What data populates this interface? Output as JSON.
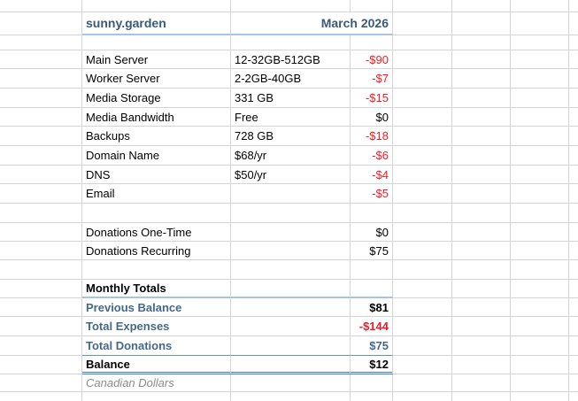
{
  "sheet": {
    "title": "sunny.garden",
    "period": "March 2026",
    "footer_note": "Canadian Dollars",
    "expenses": [
      {
        "label": "Main Server",
        "detail": "12-32GB-512GB",
        "amount": "-$90"
      },
      {
        "label": "Worker Server",
        "detail": "2-2GB-40GB",
        "amount": "-$7"
      },
      {
        "label": "Media Storage",
        "detail": "331 GB",
        "amount": "-$15"
      },
      {
        "label": "Media Bandwidth",
        "detail": "Free",
        "amount": "$0"
      },
      {
        "label": "Backups",
        "detail": "728 GB",
        "amount": "-$18"
      },
      {
        "label": "Domain Name",
        "detail": "$68/yr",
        "amount": "-$6"
      },
      {
        "label": "DNS",
        "detail": "$50/yr",
        "amount": "-$4"
      },
      {
        "label": "Email",
        "detail": "",
        "amount": "-$5"
      }
    ],
    "donations": [
      {
        "label": "Donations One-Time",
        "amount": "$0"
      },
      {
        "label": "Donations Recurring",
        "amount": "$75"
      }
    ],
    "totals_header": "Monthly Totals",
    "totals": [
      {
        "label": "Previous Balance",
        "amount": "$81"
      },
      {
        "label": "Total Expenses",
        "amount": "-$144"
      },
      {
        "label": "Total Donations",
        "amount": "$75"
      },
      {
        "label": "Balance",
        "amount": "$12"
      }
    ]
  },
  "colors": {
    "gridline": "#d4d4d4",
    "header_slate": "#3c5a78",
    "accent_slate": "#45688b",
    "negative_red": "#ee1c25",
    "border_blue_light": "#a9c4e2",
    "border_blue": "#5e93c8",
    "border_blue_strong": "#3f7cbf",
    "muted_gray": "#8b8b8b"
  }
}
